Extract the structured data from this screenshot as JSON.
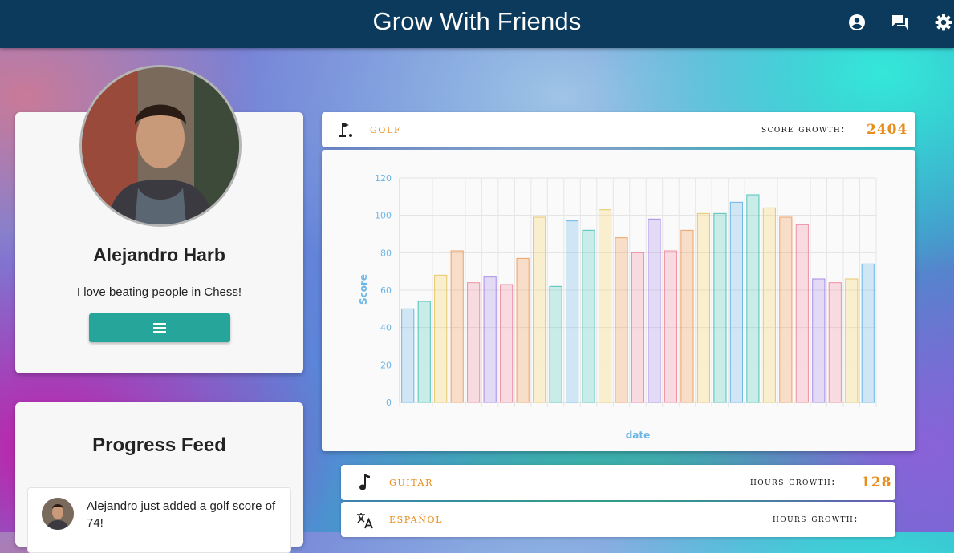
{
  "app": {
    "title": "Grow With Friends"
  },
  "header": {
    "icons": [
      "account-circle-icon",
      "forum-icon",
      "settings-icon"
    ]
  },
  "profile": {
    "name": "Alejandro Harb",
    "bio": "I love beating people in Chess!",
    "menu_icon": "menu-icon"
  },
  "feed": {
    "title": "Progress Feed",
    "items": [
      {
        "text": "Alejandro just added a golf score of 74!"
      }
    ]
  },
  "activities": [
    {
      "name": "golf",
      "icon": "golf-icon",
      "metric_label": "score growth:",
      "metric_value": "2404"
    },
    {
      "name": "guitar",
      "icon": "music-note-icon",
      "metric_label": "hours growth:",
      "metric_value": "128"
    },
    {
      "name": "español",
      "icon": "translate-icon",
      "metric_label": "hours growth:",
      "metric_value": ""
    }
  ],
  "colors": {
    "accent": "#e88c1c",
    "header": "#0b3a5c",
    "button": "#26a69a",
    "axis": "#6bb6e6"
  },
  "chart_data": {
    "type": "bar",
    "xlabel": "date",
    "ylabel": "Score",
    "ylim": [
      0,
      120
    ],
    "yticks": [
      0,
      20,
      40,
      60,
      80,
      100,
      120
    ],
    "grid": true,
    "values": [
      50,
      54,
      68,
      81,
      64,
      67,
      63,
      77,
      99,
      62,
      97,
      92,
      103,
      88,
      80,
      98,
      81,
      92,
      101,
      101,
      107,
      111,
      104,
      99,
      95,
      66,
      64,
      66,
      74
    ]
  }
}
